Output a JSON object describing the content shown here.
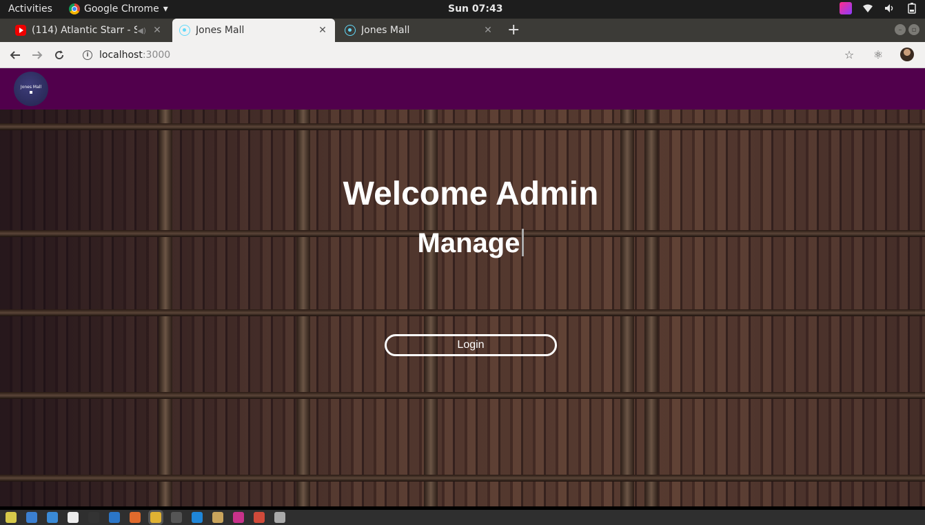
{
  "topbar": {
    "activities": "Activities",
    "app_name": "Google Chrome",
    "app_menu_arrow": "▾",
    "clock": "Sun 07:43"
  },
  "tabs": [
    {
      "title": "(114) Atlantic Starr - Se",
      "favicon": "youtube-icon",
      "active": false
    },
    {
      "title": "Jones Mall",
      "favicon": "react-icon",
      "active": true
    },
    {
      "title": "Jones Mall",
      "favicon": "react-icon",
      "active": false
    }
  ],
  "address_bar": {
    "host": "localhost",
    "port": ":3000"
  },
  "app": {
    "brand_text": "Jones Mall",
    "heading": "Welcome Admin",
    "typed_text": "Manage",
    "login_label": "Login"
  },
  "colors": {
    "navbar": "#51004c",
    "topbar": "#1d1d1d",
    "tabstrip": "#3c3b37"
  },
  "taskbar": {
    "apps": [
      {
        "name": "system-monitor-icon",
        "color": "#d6c94a"
      },
      {
        "name": "text-editor-icon",
        "color": "#3b7fd0"
      },
      {
        "name": "help-icon",
        "color": "#3a8ad6"
      },
      {
        "name": "amazon-icon",
        "color": "#eeeeee"
      },
      {
        "name": "terminal-icon",
        "color": "#333333"
      },
      {
        "name": "thunderbird-icon",
        "color": "#2b76c8"
      },
      {
        "name": "software-center-icon",
        "color": "#e06a2c"
      },
      {
        "name": "chrome-icon",
        "color": "#e0b233",
        "active": true
      },
      {
        "name": "video-editor-icon",
        "color": "#555555"
      },
      {
        "name": "vscode-icon",
        "color": "#1f86d8"
      },
      {
        "name": "files-icon",
        "color": "#c9a45c"
      },
      {
        "name": "intellij-icon",
        "color": "#c8328a"
      },
      {
        "name": "settings-icon",
        "color": "#d04a3a"
      },
      {
        "name": "printer-icon",
        "color": "#aaaaaa"
      }
    ]
  }
}
